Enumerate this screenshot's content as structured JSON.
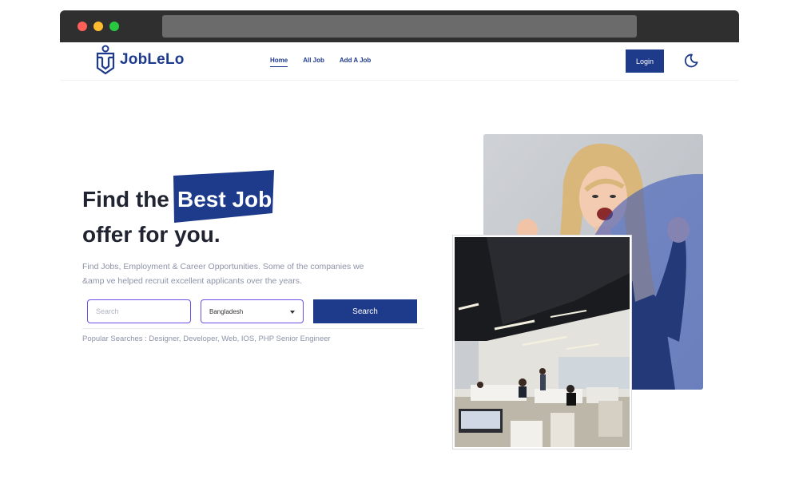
{
  "brand": {
    "name": "JobLeLo",
    "color": "#1e3a8a"
  },
  "nav": {
    "links": [
      {
        "label": "Home",
        "active": true
      },
      {
        "label": "All Job",
        "active": false
      },
      {
        "label": "Add A Job",
        "active": false
      }
    ],
    "login_label": "Login",
    "theme_icon": "moon-icon"
  },
  "hero": {
    "title_part1": "Find the",
    "title_highlight": "Best Job",
    "title_line2": "offer for you.",
    "description": "Find Jobs, Employment & Career Opportunities. Some of the companies we &amp ve helped recruit excellent applicants over the years."
  },
  "search": {
    "placeholder": "Search",
    "country_selected": "Bangladesh",
    "button_label": "Search"
  },
  "popular_searches": "Popular Searches : Designer, Developer, Web, IOS, PHP Senior Engineer",
  "images": {
    "woman": "cheering-woman-photo",
    "office": "office-interior-photo"
  }
}
